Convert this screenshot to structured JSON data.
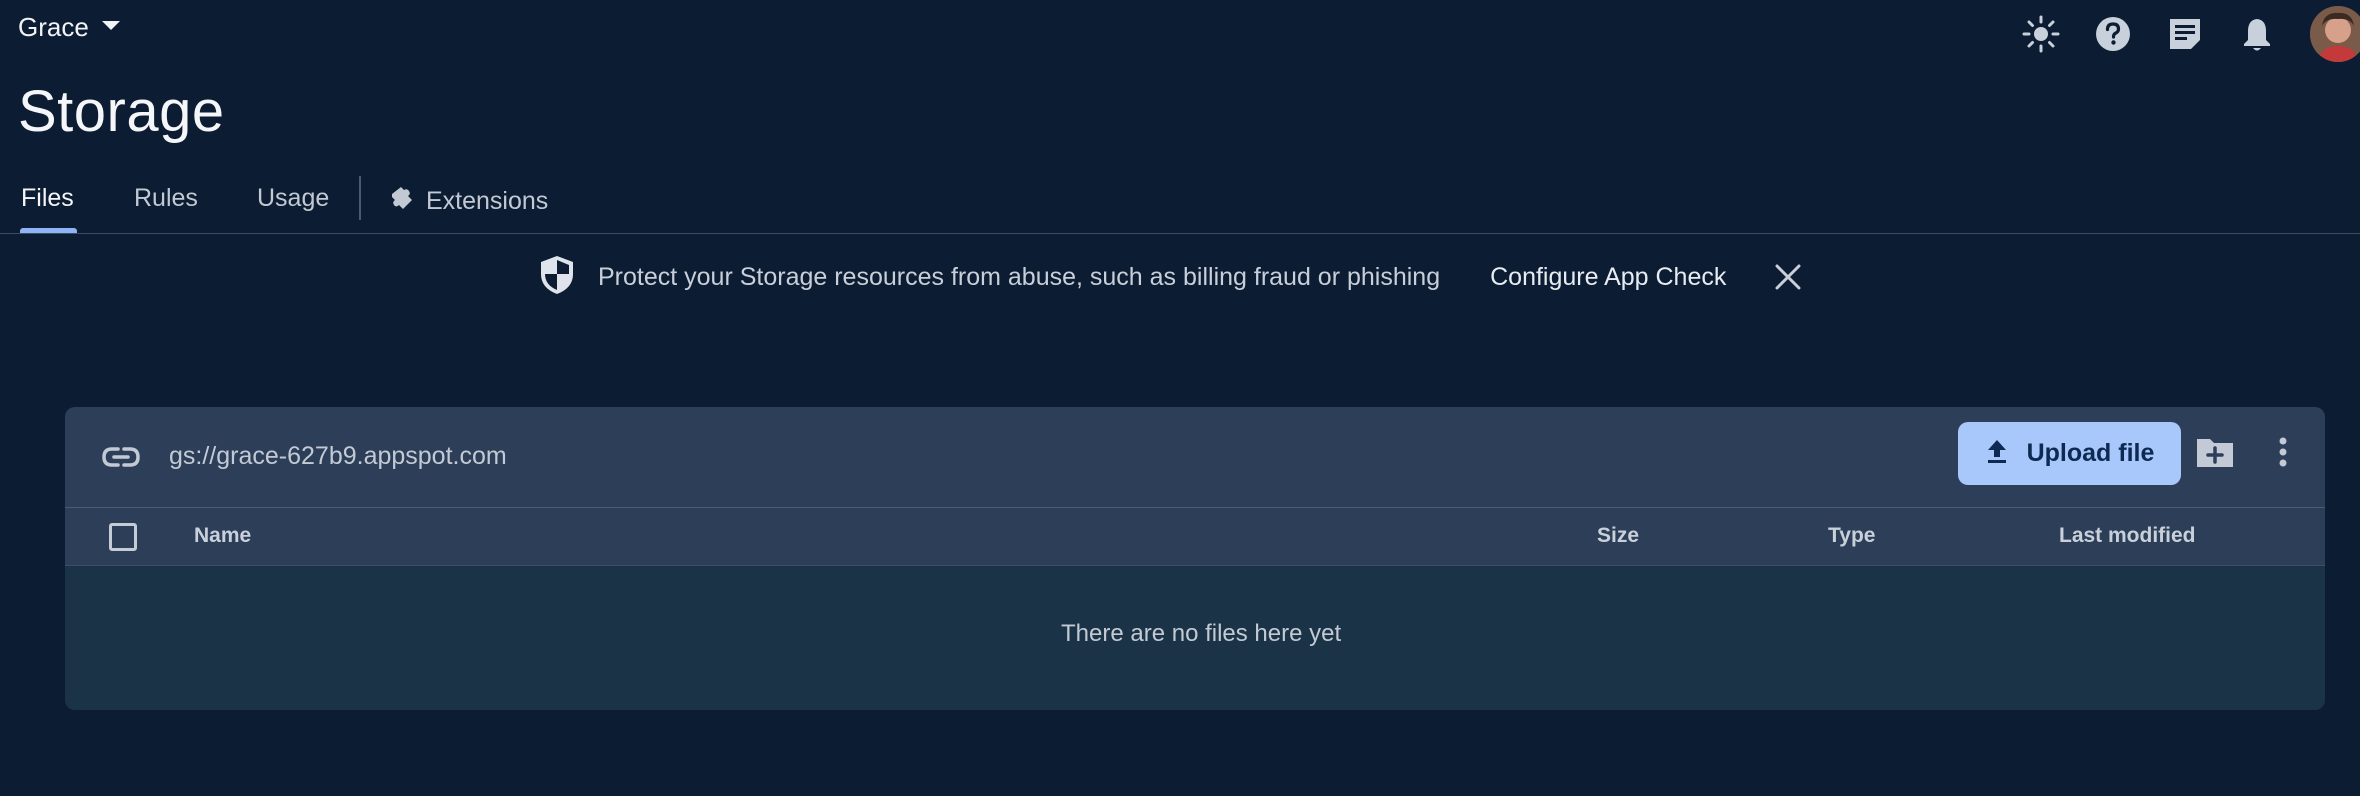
{
  "header": {
    "project_name": "Grace"
  },
  "page": {
    "title": "Storage"
  },
  "tabs": [
    {
      "label": "Files",
      "active": true
    },
    {
      "label": "Rules",
      "active": false
    },
    {
      "label": "Usage",
      "active": false
    },
    {
      "label": "Extensions",
      "active": false,
      "icon": "extensions-icon"
    }
  ],
  "banner": {
    "icon": "shield-icon",
    "message": "Protect your Storage resources from abuse, such as billing fraud or phishing",
    "link_label": "Configure App Check"
  },
  "bucket": {
    "url": "gs://grace-627b9.appspot.com",
    "upload_label": "Upload file"
  },
  "table": {
    "columns": [
      "Name",
      "Size",
      "Type",
      "Last modified"
    ],
    "rows": [],
    "empty_message": "There are no files here yet"
  },
  "colors": {
    "background": "#0b1c33",
    "card_header": "#2c3e58",
    "accent": "#a8c7fa",
    "tab_underline": "#8fb3f4"
  }
}
